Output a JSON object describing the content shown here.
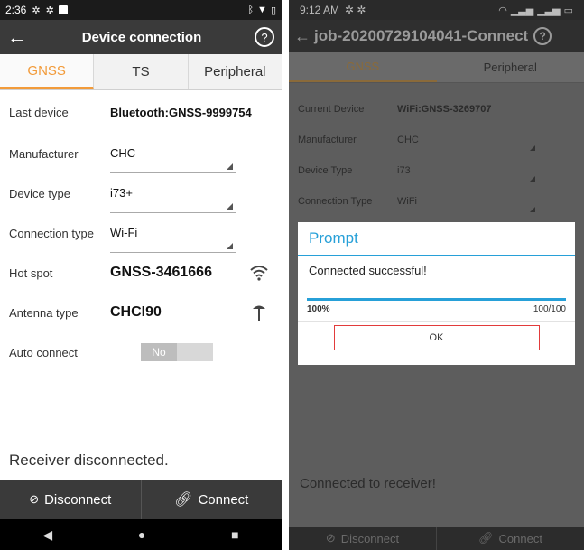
{
  "left": {
    "status": {
      "time": "2:36"
    },
    "title": "Device connection",
    "tabs": [
      {
        "label": "GNSS",
        "active": true
      },
      {
        "label": "TS",
        "active": false
      },
      {
        "label": "Peripheral",
        "active": false
      }
    ],
    "fields": {
      "last_device": {
        "label": "Last device",
        "value": "Bluetooth:GNSS-9999754"
      },
      "manufacturer": {
        "label": "Manufacturer",
        "value": "CHC"
      },
      "device_type": {
        "label": "Device type",
        "value": "i73+"
      },
      "connection_type": {
        "label": "Connection type",
        "value": "Wi-Fi"
      },
      "hot_spot": {
        "label": "Hot spot",
        "value": "GNSS-3461666"
      },
      "antenna_type": {
        "label": "Antenna type",
        "value": "CHCI90"
      },
      "auto_connect": {
        "label": "Auto connect",
        "value": "No"
      }
    },
    "message": "Receiver disconnected.",
    "buttons": {
      "disconnect": "Disconnect",
      "connect": "Connect"
    }
  },
  "right": {
    "status": {
      "time": "9:12 AM"
    },
    "title": "job-20200729104041-Connect",
    "tabs": [
      {
        "label": "GNSS",
        "active": true
      },
      {
        "label": "Peripheral",
        "active": false
      }
    ],
    "fields": {
      "current_device": {
        "label": "Current Device",
        "value": "WiFi:GNSS-3269707"
      },
      "manufacturer": {
        "label": "Manufacturer",
        "value": "CHC"
      },
      "device_type": {
        "label": "Device Type",
        "value": "i73"
      },
      "connection_type": {
        "label": "Connection Type",
        "value": "WiFi"
      }
    },
    "dialog": {
      "title": "Prompt",
      "message": "Connected successful!",
      "progress_percent": "100%",
      "progress_count": "100/100",
      "progress_fraction": 1.0,
      "ok_label": "OK"
    },
    "message": "Connected to receiver!",
    "buttons": {
      "disconnect": "Disconnect",
      "connect": "Connect"
    }
  },
  "colors": {
    "accent_orange": "#f29b3a",
    "accent_blue": "#27a0d8",
    "highlight_red": "#e23b3b"
  },
  "icons": [
    "back-arrow-icon",
    "help-icon",
    "wifi-icon",
    "antenna-icon",
    "unlink-icon",
    "link-icon",
    "nav-back-icon",
    "nav-home-icon",
    "nav-recents-icon"
  ]
}
